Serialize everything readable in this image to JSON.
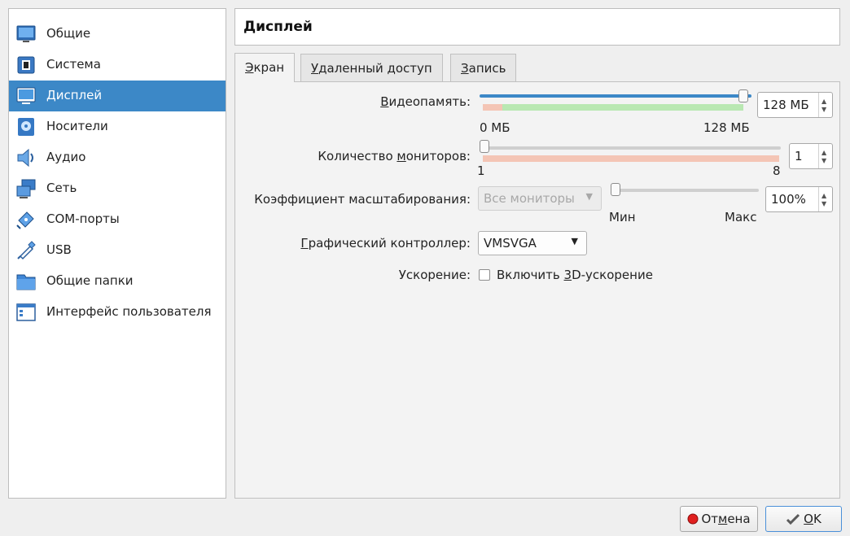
{
  "sidebar": {
    "items": [
      {
        "label": "Общие",
        "icon": "monitor-general-icon"
      },
      {
        "label": "Система",
        "icon": "chip-icon"
      },
      {
        "label": "Дисплей",
        "icon": "display-icon",
        "selected": true
      },
      {
        "label": "Носители",
        "icon": "storage-disk-icon"
      },
      {
        "label": "Аудио",
        "icon": "speaker-icon"
      },
      {
        "label": "Сеть",
        "icon": "network-icon"
      },
      {
        "label": "COM-порты",
        "icon": "serial-port-icon"
      },
      {
        "label": "USB",
        "icon": "usb-icon"
      },
      {
        "label": "Общие папки",
        "icon": "shared-folder-icon"
      },
      {
        "label": "Интерфейс пользователя",
        "icon": "user-interface-icon"
      }
    ]
  },
  "header": {
    "title": "Дисплей"
  },
  "tabs": [
    {
      "label_u": "Э",
      "label_rest": "кран",
      "active": true
    },
    {
      "label_u": "У",
      "label_rest": "даленный доступ",
      "active": false
    },
    {
      "label_u": "З",
      "label_rest": "апись",
      "active": false
    }
  ],
  "screen": {
    "video_memory": {
      "label_u": "В",
      "label_rest": "идеопамять:",
      "value": "128 МБ",
      "min_label": "0 МБ",
      "max_label": "128 МБ",
      "level": 1.0
    },
    "monitor_count": {
      "label_pre": "Количество ",
      "label_u": "м",
      "label_rest": "ониторов:",
      "value": "1",
      "min_label": "1",
      "max_label": "8",
      "level": 0.0
    },
    "scale_factor": {
      "label": "Коэффициент масштабирования:",
      "monitor_select": "Все мониторы",
      "value": "100%",
      "min_label": "Мин",
      "max_label": "Макс",
      "level": 0.0
    },
    "graphics_controller": {
      "label_u": "Г",
      "label_rest": "рафический контроллер:",
      "value": "VMSVGA"
    },
    "acceleration": {
      "label": "Ускорение:",
      "checkbox_pre": "Включить ",
      "checkbox_u": "3",
      "checkbox_rest": "D-ускорение",
      "checked": false
    }
  },
  "buttons": {
    "cancel": {
      "pre": "От",
      "u": "м",
      "rest": "ена"
    },
    "ok": {
      "u": "О",
      "rest": "K"
    }
  },
  "colors": {
    "accent": "#3c88c7",
    "green_zone": "#b9e8b2",
    "red_zone": "#f4c5b5"
  }
}
